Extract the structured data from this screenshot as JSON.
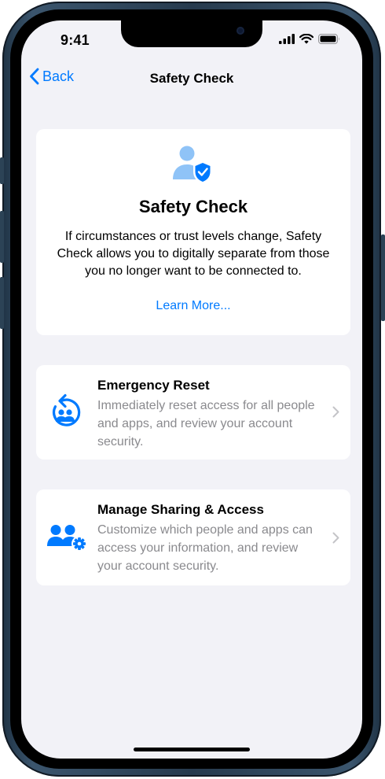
{
  "status": {
    "time": "9:41"
  },
  "nav": {
    "back_label": "Back",
    "title": "Safety Check"
  },
  "hero": {
    "icon": "person-shield-icon",
    "title": "Safety Check",
    "description": "If circumstances or trust levels change, Safety Check allows you to digitally separate from those you no longer want to be connected to.",
    "link_label": "Learn More..."
  },
  "options": [
    {
      "icon": "emergency-reset-icon",
      "title": "Emergency Reset",
      "description": "Immediately reset access for all people and apps, and review your account security."
    },
    {
      "icon": "people-gear-icon",
      "title": "Manage Sharing & Access",
      "description": "Customize which people and apps can access your information, and review your account security."
    }
  ],
  "colors": {
    "accent": "#007aff",
    "icon_light": "#8fc3f7",
    "background": "#f2f2f7",
    "secondary_text": "#8a8a8e"
  }
}
